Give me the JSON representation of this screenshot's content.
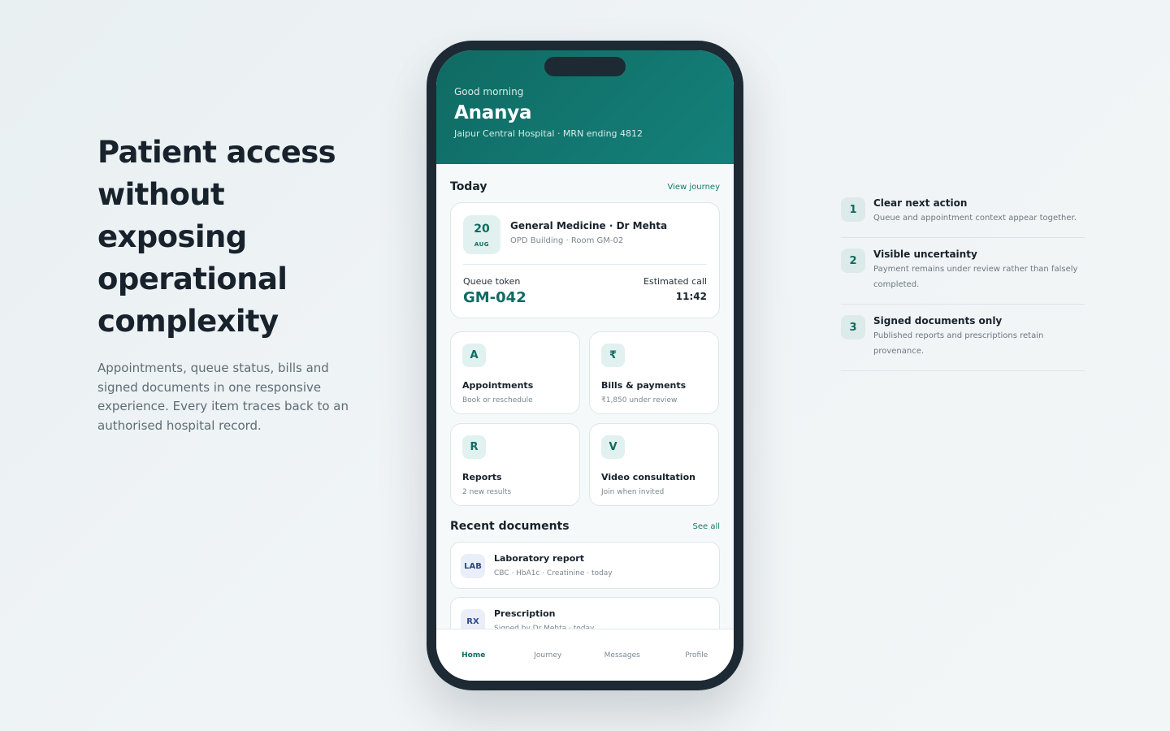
{
  "hero": {
    "title": "Patient access without exposing operational complexity",
    "subtitle": "Appointments, queue status, bills and signed documents in one responsive experience. Every item traces back to an authorised hospital record."
  },
  "phone": {
    "header": {
      "greeting": "Good morning",
      "name": "Ananya",
      "meta": "Jaipur Central Hospital · MRN ending 4812"
    },
    "today": {
      "title": "Today",
      "link": "View journey",
      "appointment": {
        "day": "20",
        "month": "AUG",
        "title": "General Medicine · Dr Mehta",
        "location": "OPD Building · Room GM-02",
        "token_label": "Queue token",
        "token": "GM-042",
        "estimate_label": "Estimated call",
        "estimate_time": "11:42"
      }
    },
    "tiles": [
      {
        "badge": "A",
        "title": "Appointments",
        "subtitle": "Book or reschedule"
      },
      {
        "badge": "₹",
        "title": "Bills & payments",
        "subtitle": "₹1,850 under review"
      },
      {
        "badge": "R",
        "title": "Reports",
        "subtitle": "2 new results"
      },
      {
        "badge": "V",
        "title": "Video consultation",
        "subtitle": "Join when invited"
      }
    ],
    "documents": {
      "title": "Recent documents",
      "link": "See all",
      "items": [
        {
          "tag": "LAB",
          "title": "Laboratory report",
          "subtitle": "CBC · HbA1c · Creatinine · today"
        },
        {
          "tag": "RX",
          "title": "Prescription",
          "subtitle": "Signed by Dr Mehta · today"
        }
      ]
    },
    "nav": [
      "Home",
      "Journey",
      "Messages",
      "Profile"
    ]
  },
  "features": [
    {
      "num": "1",
      "title": "Clear next action",
      "desc": "Queue and appointment context appear together."
    },
    {
      "num": "2",
      "title": "Visible uncertainty",
      "desc": "Payment remains under review rather than falsely completed."
    },
    {
      "num": "3",
      "title": "Signed documents only",
      "desc": "Published reports and prescriptions retain provenance."
    }
  ],
  "colors": {
    "accent": "#0f6b63",
    "phone_frame": "#1d2a34"
  }
}
